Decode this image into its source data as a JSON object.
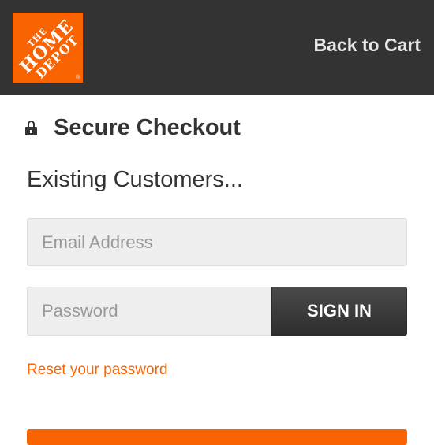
{
  "header": {
    "logo": {
      "line1": "THE",
      "line2": "HOME",
      "line3": "DEPOT",
      "registered": "®"
    },
    "back_link_label": "Back to Cart"
  },
  "checkout": {
    "lock_icon": "lock-icon",
    "title": "Secure Checkout",
    "subheading": "Existing Customers...",
    "email_placeholder": "Email Address",
    "email_value": "",
    "password_placeholder": "Password",
    "password_value": "",
    "signin_label": "SIGN IN",
    "reset_link_label": "Reset your password"
  },
  "colors": {
    "header_bg": "#333333",
    "brand_orange": "#f96302",
    "input_bg": "#eeeeee",
    "button_dark": "#333333"
  }
}
